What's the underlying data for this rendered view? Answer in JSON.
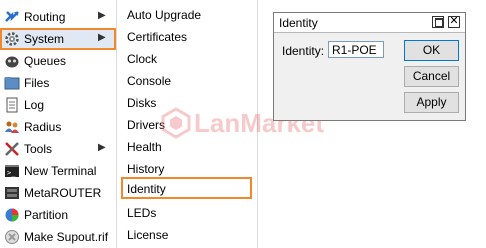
{
  "left_menu": {
    "items": [
      {
        "label": "Routing",
        "icon": "routing-icon",
        "has_submenu": true
      },
      {
        "label": "System",
        "icon": "system-gear-icon",
        "has_submenu": true,
        "selected": true
      },
      {
        "label": "Queues",
        "icon": "queues-icon"
      },
      {
        "label": "Files",
        "icon": "folder-icon"
      },
      {
        "label": "Log",
        "icon": "log-icon"
      },
      {
        "label": "Radius",
        "icon": "radius-users-icon"
      },
      {
        "label": "Tools",
        "icon": "tools-icon",
        "has_submenu": true
      },
      {
        "label": "New Terminal",
        "icon": "terminal-icon"
      },
      {
        "label": "MetaROUTER",
        "icon": "metarouter-icon"
      },
      {
        "label": "Partition",
        "icon": "partition-pie-icon"
      },
      {
        "label": "Make Supout.rif",
        "icon": "supout-icon"
      }
    ],
    "submenu_arrow": "▶"
  },
  "submenu": {
    "items": [
      {
        "label": "Auto Upgrade"
      },
      {
        "label": "Certificates"
      },
      {
        "label": "Clock"
      },
      {
        "label": "Console"
      },
      {
        "label": "Disks"
      },
      {
        "label": "Drivers"
      },
      {
        "label": "Health"
      },
      {
        "label": "History"
      },
      {
        "label": "Identity",
        "selected": true
      },
      {
        "label": "LEDs"
      },
      {
        "label": "License"
      }
    ]
  },
  "watermark": {
    "text": "LanMarket",
    "tm": "TM"
  },
  "dialog": {
    "title": "Identity",
    "field_label": "Identity:",
    "field_value": "R1-POE",
    "ok_label": "OK",
    "cancel_label": "Cancel",
    "apply_label": "Apply",
    "close_glyph": "✕"
  },
  "colors": {
    "highlight_border": "#f0892b",
    "selected_bg": "#dfe8f3",
    "dialog_bg": "#f0f0f0"
  }
}
